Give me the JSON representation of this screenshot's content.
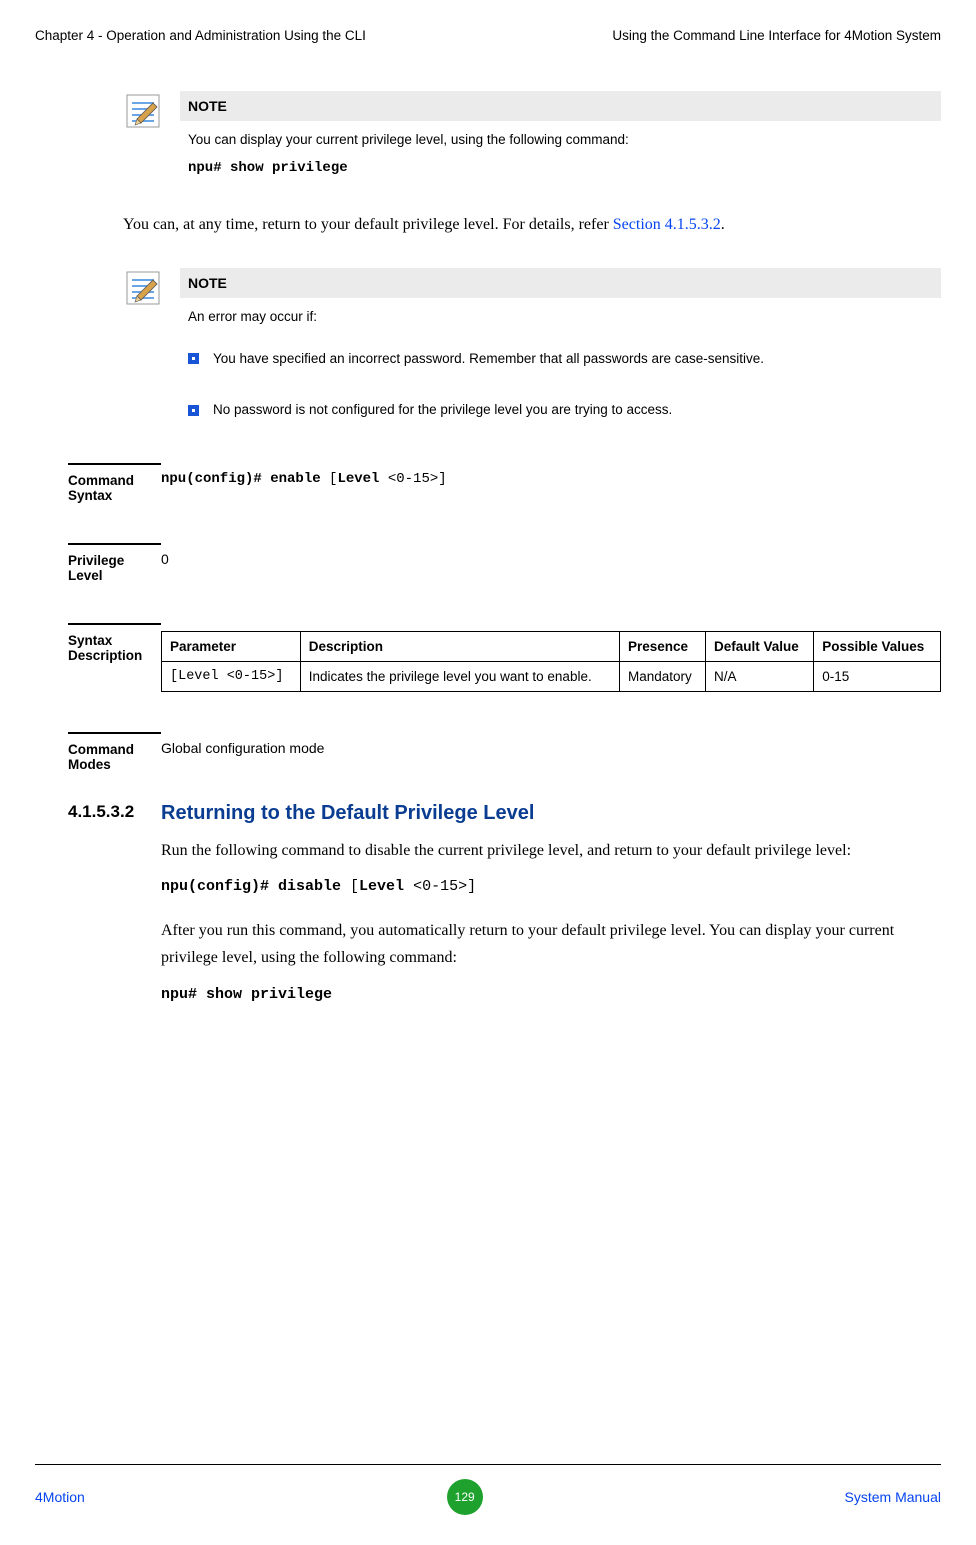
{
  "header": {
    "left": "Chapter 4 - Operation and Administration Using the CLI",
    "right": "Using the Command Line Interface for 4Motion System"
  },
  "note1": {
    "title": "NOTE",
    "line1": "You can display your current privilege level, using the following command:",
    "cmd": "npu# show privilege"
  },
  "para1_pre": "You can, at any time, return to your default privilege level. For details, refer ",
  "para1_xref": "Section 4.1.5.3.2",
  "para1_post": ".",
  "note2": {
    "title": "NOTE",
    "intro": "An error may occur if:",
    "b1": "You have specified an incorrect password. Remember that all passwords are case-sensitive.",
    "b2": "No password is not configured for the privilege level you are trying to access."
  },
  "cmd_syntax": {
    "label": "Command Syntax",
    "pre": "npu(config)# enable ",
    "mid_open": "[",
    "mid_bold": "Level",
    "mid_tail": " <0-15>]"
  },
  "priv_level": {
    "label": "Privilege Level",
    "value": "0"
  },
  "syntax_desc": {
    "label": "Syntax Description",
    "th1": "Parameter",
    "th2": "Description",
    "th3": "Presence",
    "th4": "Default Value",
    "th5": "Possible Values",
    "td1": "[Level <0-15>]",
    "td2": "Indicates the privilege level you want to enable.",
    "td3": "Mandatory",
    "td4": "N/A",
    "td5": "0-15"
  },
  "cmd_modes": {
    "label": "Command Modes",
    "value": "Global configuration mode"
  },
  "section": {
    "num": "4.1.5.3.2",
    "title": "Returning to the Default Privilege Level",
    "para1": "Run the following command to disable the current privilege level, and return to your default privilege level:",
    "cmd_pre": "npu(config)# disable ",
    "cmd_open": "[",
    "cmd_bold": "Level",
    "cmd_tail": " <0-15>]",
    "para2": "After you run this command, you automatically return to your default privilege level. You can display your current privilege level, using the following command:",
    "cmd2": "npu# show privilege"
  },
  "footer": {
    "left": "4Motion",
    "page": "129",
    "right": "System Manual"
  }
}
